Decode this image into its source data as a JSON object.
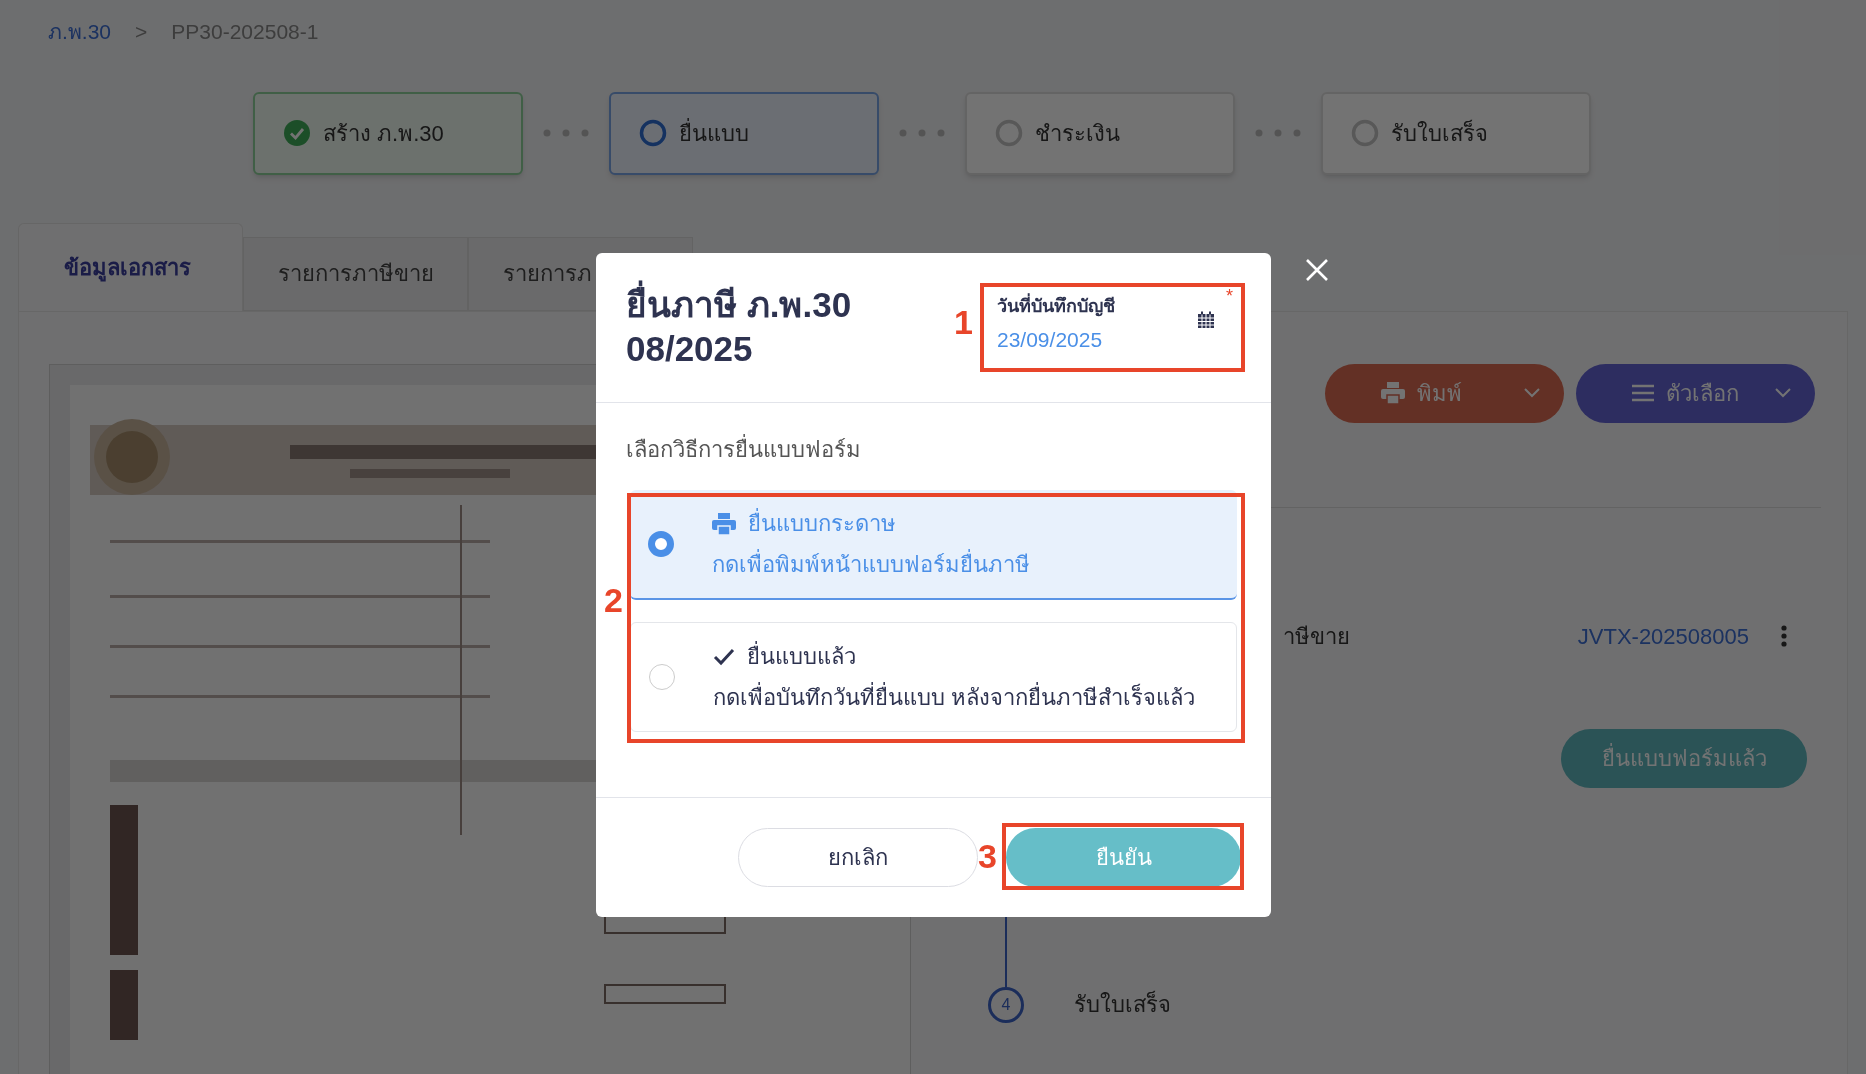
{
  "breadcrumb": {
    "link": "ภ.พ.30",
    "separator": ">",
    "current": "PP30-202508-1"
  },
  "steps": [
    {
      "label": "สร้าง ภ.พ.30",
      "done": true,
      "selected": false
    },
    {
      "label": "ยื่นแบบ",
      "done": false,
      "selected": true
    },
    {
      "label": "ชำระเงิน",
      "done": false,
      "selected": false
    },
    {
      "label": "รับใบเสร็จ",
      "done": false,
      "selected": false
    }
  ],
  "tabs": [
    {
      "label": "ข้อมูลเอกสาร",
      "selected": true
    },
    {
      "label": "รายการภาษีขาย",
      "selected": false
    },
    {
      "label": "รายการภ",
      "selected": false
    }
  ],
  "actions": [
    {
      "label": "พิมพ์",
      "kind": "print"
    },
    {
      "label": "ตัวเลือก",
      "kind": "options"
    }
  ],
  "record": {
    "label": "าษีขาย",
    "reference": "JVTX-202508005"
  },
  "filed_button": "ยื่นแบบฟอร์มแล้ว",
  "timeline": [
    {
      "number": "4",
      "label": "รับใบเสร็จ"
    }
  ],
  "dialog": {
    "title_lines": [
      "ยื่นภาษี ภ.พ.30",
      "08/2025"
    ],
    "date_field": {
      "label": "วันที่บันทึกบัญชี",
      "value": "23/09/2025",
      "required_mark": "*"
    },
    "prompt": "เลือกวิธีการยื่นแบบฟอร์ม",
    "options": [
      {
        "kind": "paper",
        "title": "ยื่นแบบกระดาษ",
        "description": "กดเพื่อพิมพ์หน้าแบบฟอร์มยื่นภาษี",
        "selected": true
      },
      {
        "kind": "filed",
        "title": "ยื่นแบบแล้ว",
        "description": "กดเพื่อบันทึกวันที่ยื่นแบบ หลังจากยื่นภาษีสำเร็จแล้ว",
        "selected": false
      }
    ],
    "buttons": [
      {
        "label": "ยกเลิก",
        "kind": "secondary"
      },
      {
        "label": "ยืนยัน",
        "kind": "primary"
      }
    ],
    "annotations": [
      {
        "number": "1"
      },
      {
        "number": "2"
      },
      {
        "number": "3"
      }
    ]
  }
}
